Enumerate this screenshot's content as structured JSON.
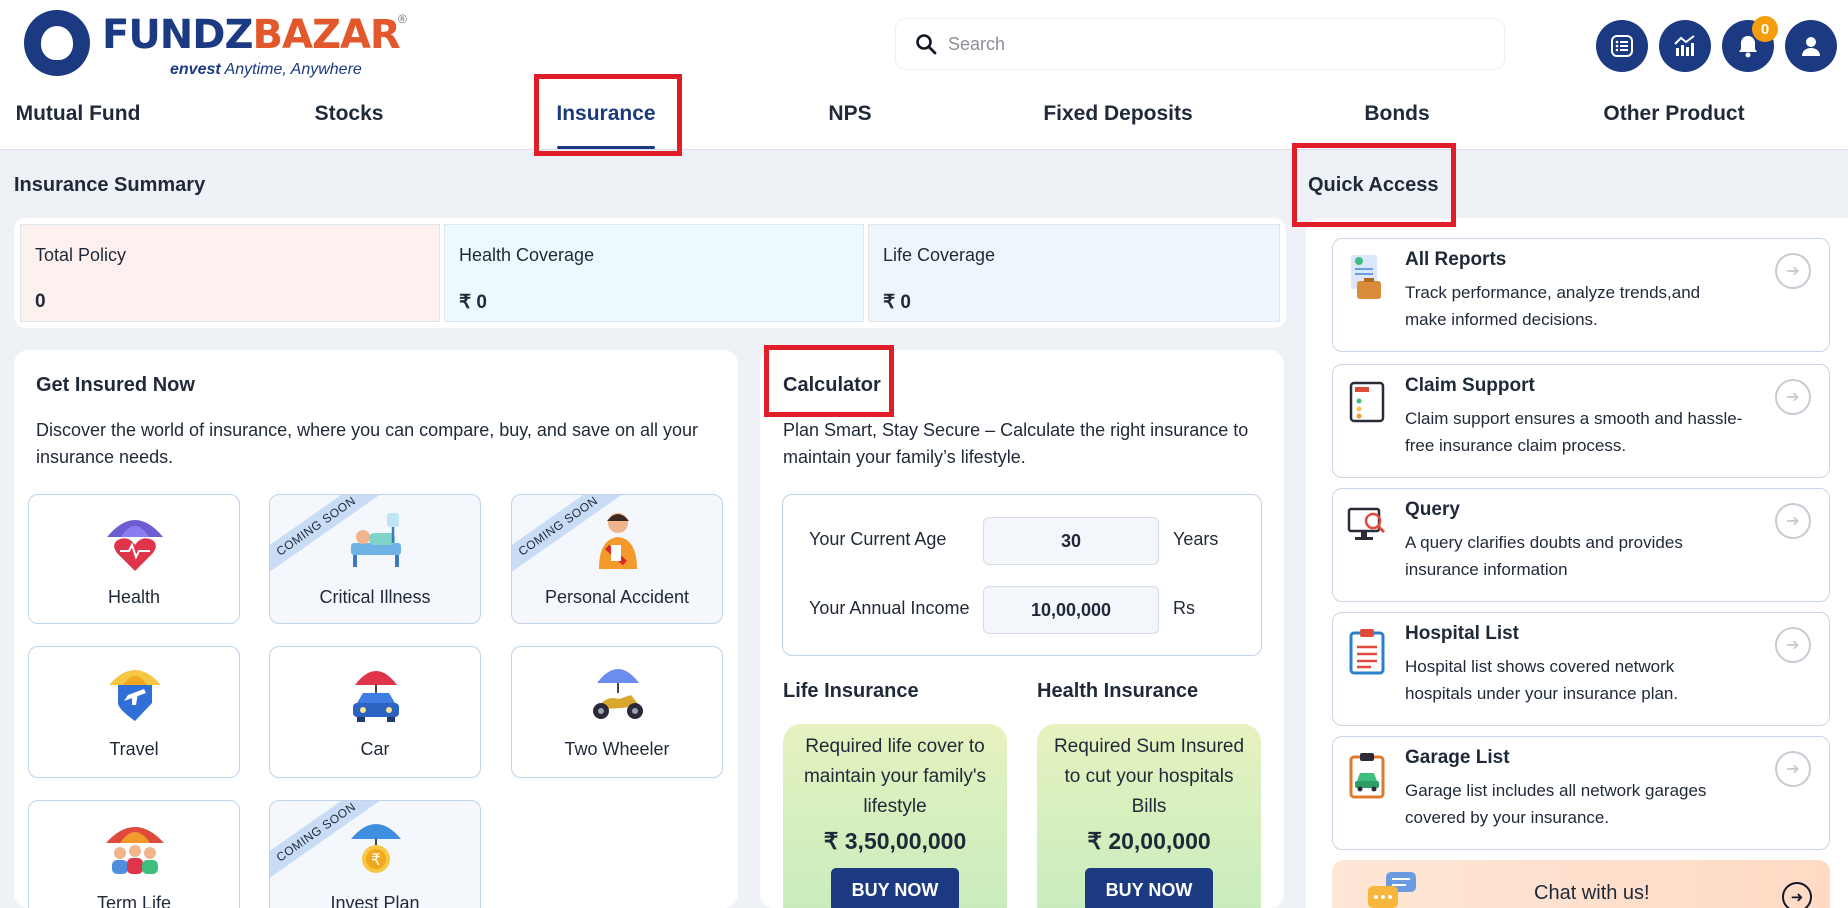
{
  "brand": {
    "logo_word_1": "FUNDZ",
    "logo_word_2": "BAZAR",
    "registered": "®",
    "tag_prefix": "envest",
    "tag_rest": " Anytime, Anywhere"
  },
  "search": {
    "placeholder": "Search"
  },
  "header_icons": {
    "menu": "list-icon",
    "portfolio": "chart-icon",
    "notifications": "bell-icon",
    "notification_count": "0",
    "profile": "user-icon"
  },
  "nav": {
    "items": [
      "Mutual Fund",
      "Stocks",
      "Insurance",
      "NPS",
      "Fixed Deposits",
      "Bonds",
      "Other Product"
    ],
    "active": "Insurance"
  },
  "summary": {
    "title": "Insurance Summary",
    "cards": [
      {
        "label": "Total Policy",
        "value": "0",
        "bg": "#fdf1ef"
      },
      {
        "label": "Health Coverage",
        "value": "₹ 0",
        "bg": "#ecf9fd"
      },
      {
        "label": "Life Coverage",
        "value": "₹ 0",
        "bg": "#eef6fc"
      }
    ]
  },
  "get_insured": {
    "title": "Get Insured Now",
    "description": "Discover the world of insurance, where you can compare, buy, and save on all your insurance needs.",
    "coming_soon": "COMING SOON",
    "tiles": [
      {
        "label": "Health",
        "icon": "umbrella-heart-icon",
        "coming_soon": false
      },
      {
        "label": "Critical Illness",
        "icon": "hospital-bed-icon",
        "coming_soon": true
      },
      {
        "label": "Personal Accident",
        "icon": "injured-person-icon",
        "coming_soon": true
      },
      {
        "label": "Travel",
        "icon": "umbrella-plane-icon",
        "coming_soon": false
      },
      {
        "label": "Car",
        "icon": "car-umbrella-icon",
        "coming_soon": false
      },
      {
        "label": "Two Wheeler",
        "icon": "scooter-umbrella-icon",
        "coming_soon": false
      },
      {
        "label": "Term Life",
        "icon": "family-umbrella-icon",
        "coming_soon": false
      },
      {
        "label": "Invest Plan",
        "icon": "rupee-coin-umbrella-icon",
        "coming_soon": true
      }
    ]
  },
  "calculator": {
    "title": "Calculator",
    "description": "Plan Smart, Stay Secure – Calculate the right insurance to maintain your family’s lifestyle.",
    "age_label": "Your Current Age",
    "age_value": "30",
    "age_unit": "Years",
    "income_label": "Your Annual Income",
    "income_value": "10,00,000",
    "income_unit": "Rs",
    "life": {
      "heading": "Life Insurance",
      "text": "Required life cover to maintain your family's lifestyle",
      "amount": "₹ 3,50,00,000",
      "button": "BUY NOW"
    },
    "health": {
      "heading": "Health Insurance",
      "text": "Required Sum Insured to cut your hospitals Bills",
      "amount": "₹ 20,00,000",
      "button": "BUY NOW"
    }
  },
  "quick_access": {
    "title": "Quick Access",
    "items": [
      {
        "title": "All Reports",
        "desc": "Track performance, analyze trends,and make informed decisions.",
        "icon": "report-briefcase-icon"
      },
      {
        "title": "Claim Support",
        "desc": "Claim support ensures a smooth and hassle-free insurance claim process.",
        "icon": "claim-form-icon"
      },
      {
        "title": "Query",
        "desc": "A query clarifies doubts and provides insurance information",
        "icon": "monitor-search-icon"
      },
      {
        "title": "Hospital List",
        "desc": "Hospital list shows covered network hospitals under your insurance plan.",
        "icon": "clipboard-list-icon"
      },
      {
        "title": "Garage List",
        "desc": "Garage list includes all network garages covered by your insurance.",
        "icon": "clipboard-car-icon"
      }
    ],
    "chat_label": "Chat with us!",
    "chat_icon": "chat-bubbles-icon"
  },
  "colors": {
    "brand_navy": "#1b3a82",
    "brand_orange": "#e2572c",
    "highlight_red": "#e11d2a",
    "notification_badge": "#f59e0b"
  }
}
